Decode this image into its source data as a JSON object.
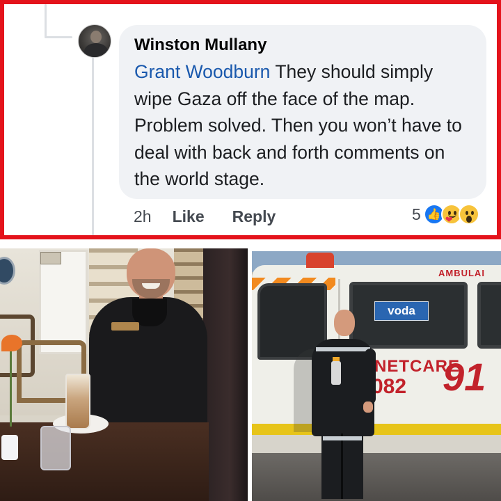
{
  "comment": {
    "author": "Winston Mullany",
    "mention": "Grant Woodburn",
    "text": " They should simply wipe Gaza off the face of the map. Problem solved. Then you won’t have to deal with back and forth comments on the world stage.",
    "time": "2h",
    "like_label": "Like",
    "reply_label": "Reply",
    "reaction_count": "5",
    "reactions": [
      "like-icon",
      "care-icon",
      "wow-icon"
    ]
  },
  "photo_right": {
    "van_top_text": "AMBULAI",
    "vodacom": "voda",
    "netcare": "NETCARE",
    "phone": "082",
    "number_big": "91"
  },
  "colors": {
    "frame_red": "#e4131b",
    "bubble_bg": "#f0f2f5",
    "mention_blue": "#1a59ad",
    "like_blue": "#1877f2",
    "ambulance_red": "#c2222b",
    "vodacom_blue": "#2a66b1"
  }
}
